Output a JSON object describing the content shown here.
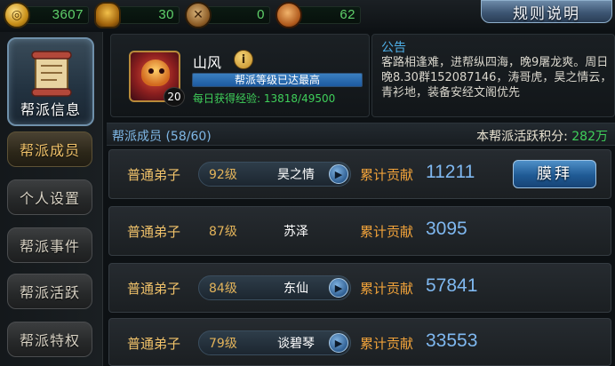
{
  "resources": [
    {
      "icon": "gold-coin-icon",
      "value": "3607"
    },
    {
      "icon": "helmet-icon",
      "value": "30"
    },
    {
      "icon": "medal-icon",
      "value": "0"
    },
    {
      "icon": "scroll-token-icon",
      "value": "62"
    }
  ],
  "rules_button": "规则说明",
  "sidebar": {
    "active": "帮派信息",
    "items": [
      "帮派成员",
      "个人设置",
      "帮派事件",
      "帮派活跃",
      "帮派特权"
    ]
  },
  "guild": {
    "name": "山风",
    "level": "20",
    "level_bar_text": "帮派等级已达最高",
    "daily_exp": "每日获得经验: 13818/49500"
  },
  "notice": {
    "title": "公告",
    "text": "客路相逢难，进帮纵四海，晚9屠龙爽。周日晚8.30群152087146，涛哥虎，昊之情云，青衫地，装备安经文阁优先"
  },
  "members_header": {
    "title": "帮派成员 (58/60)",
    "score_label": "本帮派活跃积分:",
    "score_value": "282万"
  },
  "contribution_label": "累计贡献",
  "worship_button": "膜拜",
  "members": [
    {
      "rank": "普通弟子",
      "level": "92级",
      "name": "昊之情",
      "contribution": "11211"
    },
    {
      "rank": "普通弟子",
      "level": "87级",
      "name": "苏泽",
      "contribution": "3095"
    },
    {
      "rank": "普通弟子",
      "level": "84级",
      "name": "东仙",
      "contribution": "57841"
    },
    {
      "rank": "普通弟子",
      "level": "79级",
      "name": "谈碧琴",
      "contribution": "33553"
    }
  ]
}
